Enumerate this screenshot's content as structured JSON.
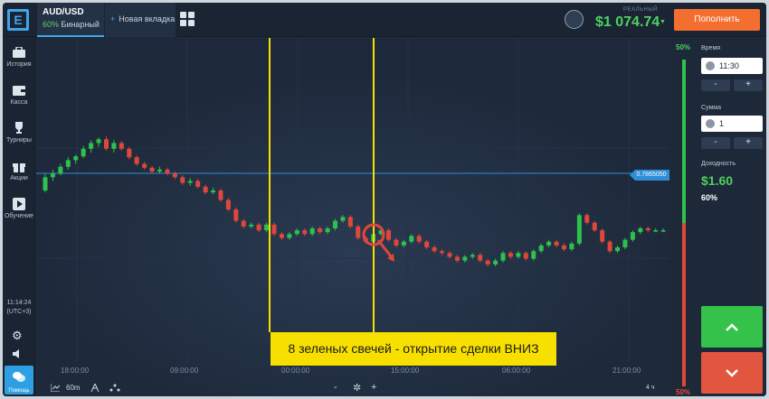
{
  "header": {
    "logo_glyph": "E",
    "asset_tab": {
      "name": "AUD/USD",
      "percent": "60%",
      "type": "Бинарный"
    },
    "new_tab_label": "Новая вкладка",
    "balance_label": "РЕАЛЬНЫЙ",
    "balance": "$1 074.74",
    "deposit_label": "Пополнить"
  },
  "sidebar": {
    "items": [
      {
        "label": "История",
        "icon": "briefcase-icon"
      },
      {
        "label": "Касса",
        "icon": "wallet-icon"
      },
      {
        "label": "Турниры",
        "icon": "trophy-icon"
      },
      {
        "label": "Акции",
        "icon": "gift-icon"
      },
      {
        "label": "Обучение",
        "icon": "play-icon"
      }
    ],
    "clock_time": "11:14:24",
    "clock_zone": "(UTC+3)",
    "help_label": "Помощь"
  },
  "chart": {
    "price_tag": "0.7865050",
    "annotation": "8 зеленых свечей - открытие сделки ВНИЗ",
    "time_labels": [
      "18:00:00",
      "09:00:00",
      "00:00:00",
      "15:00:00",
      "06:00:00",
      "21:00:00"
    ],
    "timeframe": "60m",
    "zoom_minus": "-",
    "zoom_plus": "+",
    "period_label": "4 ч",
    "colors": {
      "up": "#2ec14d",
      "down": "#e0473b",
      "marker": "#f7e000",
      "price_line": "#2e8fd8"
    }
  },
  "chart_data": {
    "type": "candlestick",
    "x_tick_labels": [
      "18:00:00",
      "09:00:00",
      "00:00:00",
      "15:00:00",
      "06:00:00",
      "21:00:00"
    ],
    "price_marker": "0.7865050",
    "annotation": "8 зеленых свечей - открытие сделки ВНИЗ",
    "candles_relative": [
      [
        60,
        74,
        58,
        78
      ],
      [
        74,
        78,
        70,
        82
      ],
      [
        78,
        85,
        76,
        88
      ],
      [
        85,
        92,
        82,
        95
      ],
      [
        92,
        96,
        88,
        98
      ],
      [
        96,
        104,
        94,
        107
      ],
      [
        104,
        110,
        100,
        113
      ],
      [
        110,
        114,
        106,
        116
      ],
      [
        114,
        104,
        102,
        117
      ],
      [
        104,
        110,
        100,
        113
      ],
      [
        110,
        104,
        102,
        112
      ],
      [
        104,
        95,
        93,
        106
      ],
      [
        95,
        88,
        86,
        97
      ],
      [
        88,
        84,
        82,
        90
      ],
      [
        84,
        80,
        78,
        86
      ],
      [
        80,
        82,
        78,
        85
      ],
      [
        82,
        78,
        76,
        84
      ],
      [
        78,
        74,
        72,
        80
      ],
      [
        74,
        68,
        66,
        76
      ],
      [
        68,
        70,
        65,
        73
      ],
      [
        70,
        64,
        62,
        72
      ],
      [
        64,
        58,
        56,
        66
      ],
      [
        58,
        60,
        56,
        63
      ],
      [
        60,
        50,
        48,
        62
      ],
      [
        50,
        40,
        38,
        52
      ],
      [
        40,
        28,
        26,
        42
      ],
      [
        28,
        22,
        20,
        30
      ],
      [
        22,
        24,
        20,
        26
      ],
      [
        24,
        18,
        16,
        26
      ],
      [
        18,
        24,
        16,
        26
      ],
      [
        24,
        14,
        12,
        26
      ],
      [
        14,
        10,
        8,
        16
      ],
      [
        10,
        14,
        8,
        16
      ],
      [
        14,
        18,
        12,
        20
      ],
      [
        18,
        14,
        12,
        20
      ],
      [
        14,
        20,
        12,
        22
      ],
      [
        20,
        16,
        14,
        22
      ],
      [
        16,
        20,
        14,
        22
      ],
      [
        20,
        28,
        18,
        30
      ],
      [
        28,
        32,
        26,
        34
      ],
      [
        32,
        22,
        20,
        34
      ],
      [
        22,
        10,
        8,
        24
      ],
      [
        10,
        6,
        4,
        12
      ],
      [
        6,
        14,
        4,
        16
      ],
      [
        14,
        18,
        12,
        20
      ],
      [
        18,
        8,
        6,
        20
      ],
      [
        8,
        2,
        0,
        10
      ],
      [
        2,
        6,
        0,
        8
      ],
      [
        6,
        12,
        4,
        14
      ],
      [
        12,
        6,
        4,
        14
      ],
      [
        6,
        0,
        -2,
        8
      ],
      [
        0,
        -4,
        -6,
        2
      ],
      [
        -4,
        -6,
        -8,
        -2
      ],
      [
        -6,
        -10,
        -12,
        -4
      ],
      [
        -10,
        -14,
        -16,
        -8
      ],
      [
        -14,
        -10,
        -16,
        -8
      ],
      [
        -10,
        -8,
        -12,
        -6
      ],
      [
        -8,
        -14,
        -16,
        -6
      ],
      [
        -14,
        -18,
        -20,
        -12
      ],
      [
        -18,
        -14,
        -20,
        -12
      ],
      [
        -14,
        -6,
        -16,
        -4
      ],
      [
        -6,
        -10,
        -12,
        -4
      ],
      [
        -10,
        -6,
        -12,
        -4
      ],
      [
        -6,
        -12,
        -14,
        -4
      ],
      [
        -12,
        -4,
        -14,
        -2
      ],
      [
        -4,
        2,
        -6,
        4
      ],
      [
        2,
        6,
        0,
        8
      ],
      [
        6,
        2,
        0,
        8
      ],
      [
        2,
        -2,
        -4,
        4
      ],
      [
        -2,
        4,
        -4,
        6
      ],
      [
        4,
        34,
        2,
        36
      ],
      [
        34,
        26,
        24,
        36
      ],
      [
        26,
        18,
        16,
        28
      ],
      [
        18,
        6,
        4,
        20
      ],
      [
        6,
        -4,
        -6,
        8
      ],
      [
        -4,
        0,
        -6,
        2
      ],
      [
        0,
        8,
        -2,
        10
      ],
      [
        8,
        16,
        6,
        18
      ],
      [
        16,
        20,
        14,
        22
      ],
      [
        20,
        18,
        16,
        22
      ],
      [
        18,
        18,
        16,
        20
      ],
      [
        18,
        18,
        16,
        20
      ]
    ],
    "sentiment": {
      "up": "50%",
      "down": "50%"
    }
  },
  "panel": {
    "time_label": "Время",
    "time_value": "11:30",
    "amount_label": "Сумма",
    "amount_value": "1",
    "minus": "-",
    "plus": "+",
    "payout_label": "Доходность",
    "payout_value": "$1.60",
    "payout_percent": "60%"
  },
  "sentiment_bar": {
    "up_label": "50%",
    "down_label": "50%",
    "up_share": 0.5
  }
}
